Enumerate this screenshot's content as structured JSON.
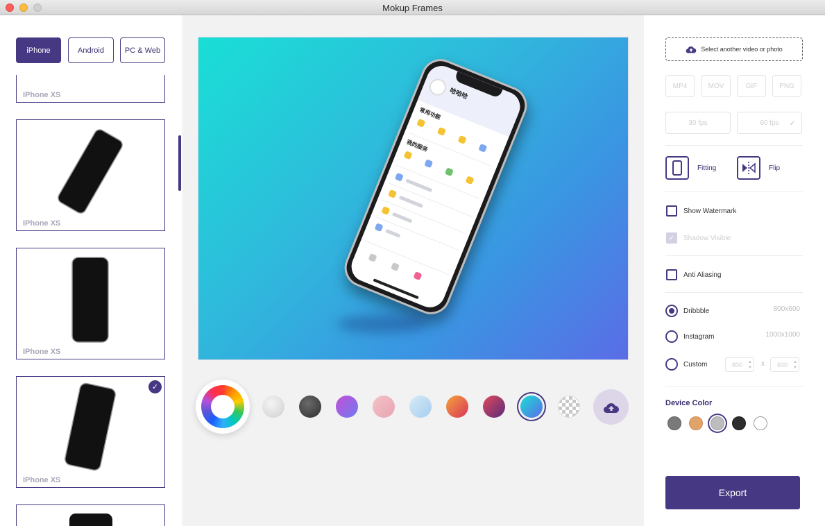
{
  "window": {
    "title": "Mokup Frames"
  },
  "categories": [
    {
      "label": "iPhone",
      "active": true
    },
    {
      "label": "Android",
      "active": false
    },
    {
      "label": "PC & Web",
      "active": false
    }
  ],
  "thumbnails": [
    {
      "label": "IPhone XS",
      "selected": false
    },
    {
      "label": "IPhone XS",
      "selected": false
    },
    {
      "label": "IPhone XS",
      "selected": false
    },
    {
      "label": "IPhone XS",
      "selected": true
    }
  ],
  "preview": {
    "app_name": "哈哈哈",
    "section1": "常用功能",
    "section2": "我的服务"
  },
  "background_swatches": {
    "colors": [
      "#d9d9d9",
      "#444444",
      "violet-gradient",
      "pink-gradient",
      "skyblue-gradient",
      "orange-gradient",
      "plum-gradient",
      "teal-gradient",
      "transparent"
    ],
    "selected_index": 7
  },
  "right": {
    "select_label": "Select another video or photo",
    "formats": [
      "MP4",
      "MOV",
      "GIF",
      "PNG"
    ],
    "fps": [
      "30 fps",
      "60 fps"
    ],
    "fitting_label": "Fitting",
    "flip_label": "Flip",
    "show_watermark": "Show Watermark",
    "shadow_visible": "Shadow Visible",
    "anti_aliasing": "Anti Aliasing",
    "sizes": [
      {
        "label": "Dribbble",
        "size": "800x600",
        "selected": true
      },
      {
        "label": "Instagram",
        "size": "1000x1000",
        "selected": false
      },
      {
        "label": "Custom",
        "size": "",
        "selected": false
      }
    ],
    "custom_width": "800",
    "custom_height": "600",
    "custom_x": "x",
    "device_color_title": "Device Color",
    "device_colors": [
      "#7a7a7a",
      "#e2a36b",
      "#bdbdbd",
      "#2e2e2e",
      "#ffffff"
    ],
    "device_color_selected": 2,
    "export_label": "Export"
  }
}
